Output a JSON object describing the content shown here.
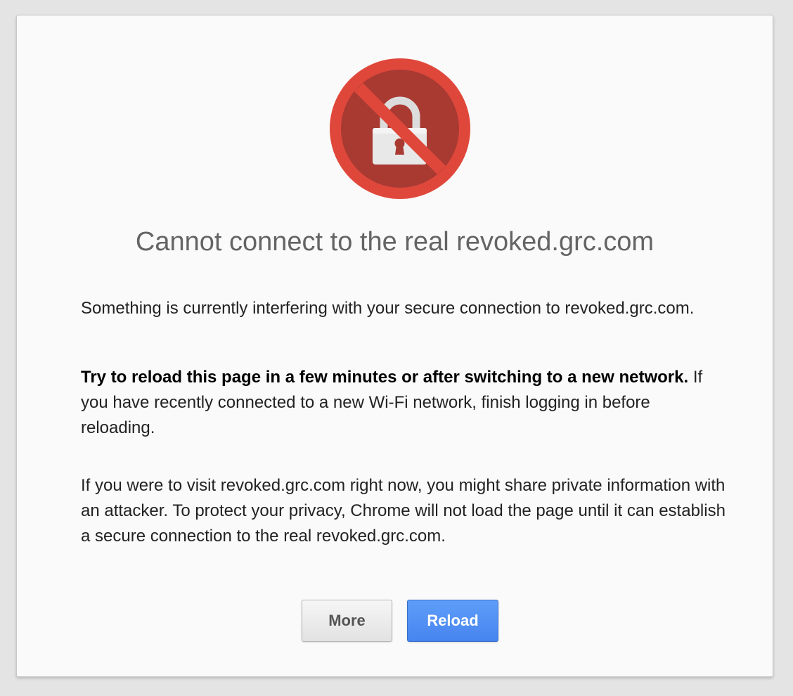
{
  "icon": "revoked-lock-icon",
  "colors": {
    "icon_ring": "#e0473b",
    "icon_inner": "#a83a32",
    "lock_body": "#e6e6e6",
    "reload_button": "#4d8bf5"
  },
  "title": "Cannot connect to the real revoked.grc.com",
  "paragraph1": "Something is currently interfering with your secure connection to revoked.grc.com.",
  "paragraph2": {
    "bold": "Try to reload this page in a few minutes or after switching to a new network.",
    "rest": " If you have recently connected to a new Wi-Fi network, finish logging in before reloading."
  },
  "paragraph3": "If you were to visit revoked.grc.com right now, you might share private information with an attacker. To protect your privacy, Chrome will not load the page until it can establish a secure connection to the real revoked.grc.com.",
  "buttons": {
    "more_label": "More",
    "reload_label": "Reload"
  }
}
